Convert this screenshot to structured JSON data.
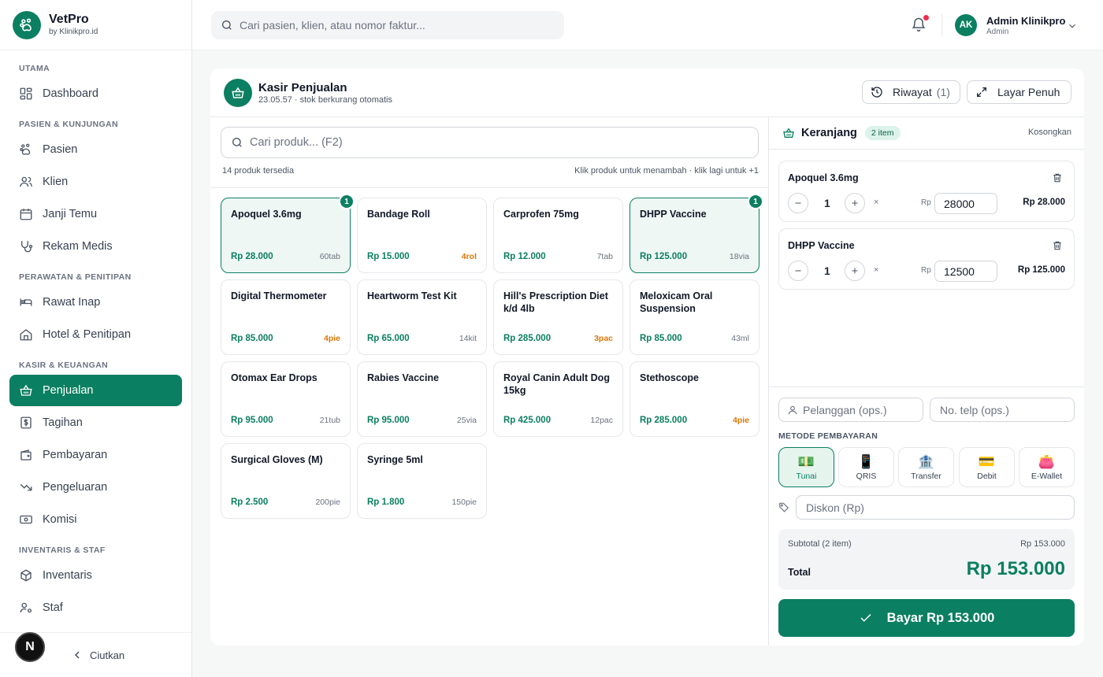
{
  "brand": {
    "name": "VetPro",
    "sub": "by Klinikpro.id"
  },
  "sidebar": {
    "sections": [
      {
        "title": "UTAMA",
        "items": [
          {
            "label": "Dashboard",
            "icon": "grid-icon"
          }
        ]
      },
      {
        "title": "PASIEN & KUNJUNGAN",
        "items": [
          {
            "label": "Pasien",
            "icon": "paw-icon"
          },
          {
            "label": "Klien",
            "icon": "users-icon"
          },
          {
            "label": "Janji Temu",
            "icon": "calendar-icon"
          },
          {
            "label": "Rekam Medis",
            "icon": "stethoscope-icon"
          }
        ]
      },
      {
        "title": "PERAWATAN & PENITIPAN",
        "items": [
          {
            "label": "Rawat Inap",
            "icon": "bed-icon"
          },
          {
            "label": "Hotel & Penitipan",
            "icon": "home-icon"
          }
        ]
      },
      {
        "title": "KASIR & KEUANGAN",
        "items": [
          {
            "label": "Penjualan",
            "icon": "basket-icon",
            "active": true
          },
          {
            "label": "Tagihan",
            "icon": "invoice-icon"
          },
          {
            "label": "Pembayaran",
            "icon": "wallet-icon"
          },
          {
            "label": "Pengeluaran",
            "icon": "trend-down-icon"
          },
          {
            "label": "Komisi",
            "icon": "money-icon"
          }
        ]
      },
      {
        "title": "INVENTARIS & STAF",
        "items": [
          {
            "label": "Inventaris",
            "icon": "box-icon"
          },
          {
            "label": "Staf",
            "icon": "user-gear-icon"
          }
        ]
      }
    ],
    "collapse_label": "Ciutkan",
    "next_badge": "N"
  },
  "topbar": {
    "search_placeholder": "Cari pasien, klien, atau nomor faktur...",
    "user": {
      "initials": "AK",
      "name": "Admin Klinikpro",
      "role": "Admin"
    }
  },
  "pos": {
    "title": "Kasir Penjualan",
    "subtitle": "23.05.57 · stok berkurang otomatis",
    "history_label": "Riwayat",
    "history_count": "(1)",
    "fullscreen_label": "Layar Penuh"
  },
  "products": {
    "search_placeholder": "Cari produk... (F2)",
    "available": "14 produk tersedia",
    "hint": "Klik produk untuk menambah · klik lagi untuk +1",
    "items": [
      {
        "name": "Apoquel 3.6mg",
        "price": "Rp 28.000",
        "stock": "60tab",
        "low": false,
        "qty": "1"
      },
      {
        "name": "Bandage Roll",
        "price": "Rp 15.000",
        "stock": "4rol",
        "low": true
      },
      {
        "name": "Carprofen 75mg",
        "price": "Rp 12.000",
        "stock": "7tab",
        "low": false
      },
      {
        "name": "DHPP Vaccine",
        "price": "Rp 125.000",
        "stock": "18via",
        "low": false,
        "qty": "1"
      },
      {
        "name": "Digital Thermometer",
        "price": "Rp 85.000",
        "stock": "4pie",
        "low": true
      },
      {
        "name": "Heartworm Test Kit",
        "price": "Rp 65.000",
        "stock": "14kit",
        "low": false
      },
      {
        "name": "Hill's Prescription Diet k/d 4lb",
        "price": "Rp 285.000",
        "stock": "3pac",
        "low": true
      },
      {
        "name": "Meloxicam Oral Suspension",
        "price": "Rp 85.000",
        "stock": "43ml",
        "low": false
      },
      {
        "name": "Otomax Ear Drops",
        "price": "Rp 95.000",
        "stock": "21tub",
        "low": false
      },
      {
        "name": "Rabies Vaccine",
        "price": "Rp 95.000",
        "stock": "25via",
        "low": false
      },
      {
        "name": "Royal Canin Adult Dog 15kg",
        "price": "Rp 425.000",
        "stock": "12pac",
        "low": false
      },
      {
        "name": "Stethoscope",
        "price": "Rp 285.000",
        "stock": "4pie",
        "low": true
      },
      {
        "name": "Surgical Gloves (M)",
        "price": "Rp 2.500",
        "stock": "200pie",
        "low": false
      },
      {
        "name": "Syringe 5ml",
        "price": "Rp 1.800",
        "stock": "150pie",
        "low": false
      }
    ]
  },
  "cart": {
    "title": "Keranjang",
    "count": "2 item",
    "clear_label": "Kosongkan",
    "items": [
      {
        "name": "Apoquel 3.6mg",
        "qty": "1",
        "times": "×",
        "rp": "Rp",
        "unit_price": "28000",
        "total": "Rp 28.000"
      },
      {
        "name": "DHPP Vaccine",
        "qty": "1",
        "times": "×",
        "rp": "Rp",
        "unit_price": "12500",
        "total": "Rp 125.000"
      }
    ],
    "customer_placeholder": "Pelanggan (ops.)",
    "phone_placeholder": "No. telp (ops.)",
    "payment_label": "METODE PEMBAYARAN",
    "payment_methods": [
      {
        "label": "Tunai",
        "emoji": "💵",
        "active": true
      },
      {
        "label": "QRIS",
        "emoji": "📱"
      },
      {
        "label": "Transfer",
        "emoji": "🏦"
      },
      {
        "label": "Debit",
        "emoji": "💳"
      },
      {
        "label": "E-Wallet",
        "emoji": "👛"
      }
    ],
    "discount_placeholder": "Diskon (Rp)",
    "subtotal_label": "Subtotal (2 item)",
    "subtotal_value": "Rp 153.000",
    "total_label": "Total",
    "total_value": "Rp 153.000",
    "pay_label": "Bayar Rp 153.000"
  },
  "colors": {
    "primary": "#0b7f61",
    "warning": "#d97706",
    "notification": "#ef2d4f"
  }
}
